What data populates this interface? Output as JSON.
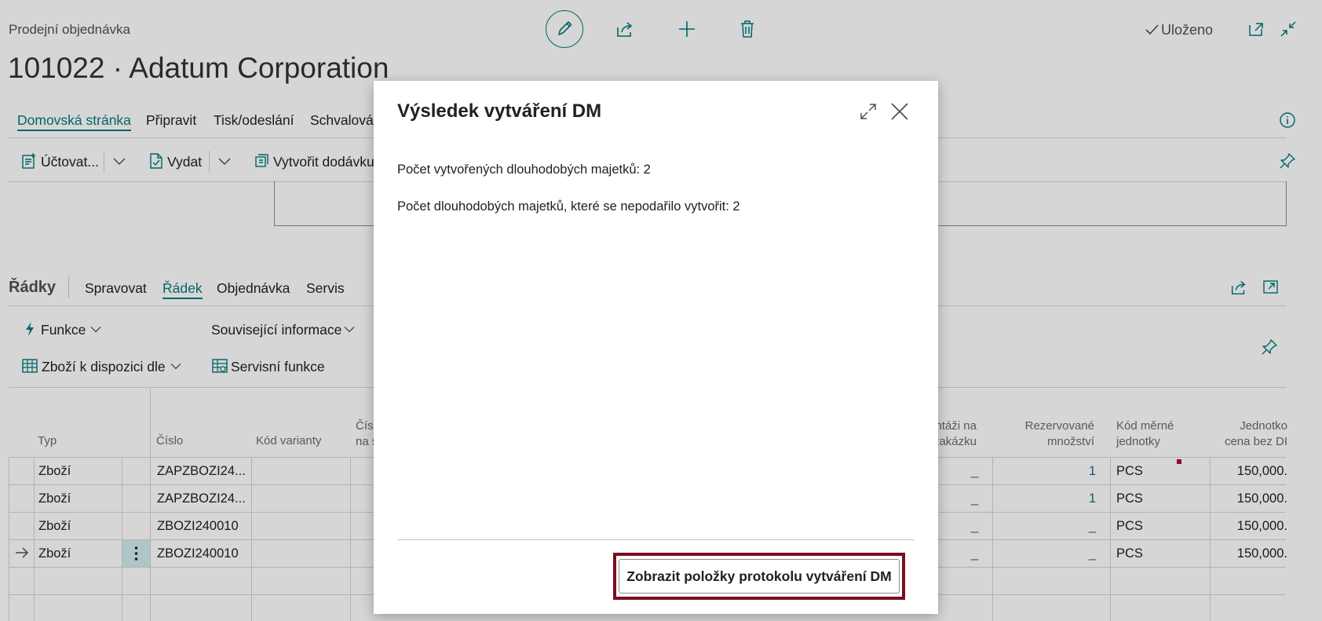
{
  "header": {
    "page_type": "Prodejní objednávka",
    "record_title": "101022 · Adatum Corporation",
    "saved_status": "Uloženo"
  },
  "action_tabs": [
    "Domovská stránka",
    "Připravit",
    "Tisk/odeslání",
    "Schvalování"
  ],
  "toolbar": {
    "post_label": "Účtovat...",
    "release_label": "Vydat",
    "create_shipment_label": "Vytvořit dodávku"
  },
  "lines_section": {
    "title": "Řádky",
    "tabs": [
      "Spravovat",
      "Řádek",
      "Objednávka",
      "Servis"
    ],
    "functions_label": "Funkce",
    "related_info_label": "Související informace",
    "item_availability_label": "Zboží k dispozici dle",
    "service_functions_label": "Servisní funkce"
  },
  "table": {
    "headers": {
      "type": "Typ",
      "number": "Číslo",
      "variant": "Kód varianty",
      "partial_col": [
        "Čís",
        "na s"
      ],
      "assembly": [
        "ntáži na",
        "zakázku"
      ],
      "reserved": [
        "Rezervované",
        "množství"
      ],
      "uom": [
        "Kód měrné",
        "jednotky"
      ],
      "unit_price": [
        "Jednotko",
        "cena bez DI"
      ]
    },
    "rows": [
      {
        "type": "Zboží",
        "number": "ZAPZBOZI24...",
        "assembly": "_",
        "reserved": "1",
        "uom": "PCS",
        "price": "150,000."
      },
      {
        "type": "Zboží",
        "number": "ZAPZBOZI24...",
        "assembly": "_",
        "reserved": "1",
        "uom": "PCS",
        "price": "150,000."
      },
      {
        "type": "Zboží",
        "number": "ZBOZI240010",
        "assembly": "_",
        "reserved": "_",
        "uom": "PCS",
        "price": "150,000."
      },
      {
        "type": "Zboží",
        "number": "ZBOZI240010",
        "assembly": "_",
        "reserved": "_",
        "uom": "PCS",
        "price": "150,000."
      }
    ]
  },
  "dialog": {
    "title": "Výsledek vytváření DM",
    "message_created": "Počet vytvořených dlouhodobých majetků: 2",
    "message_failed": "Počet dlouhodobých majetků, které se nepodařilo vytvořit: 2",
    "button_label": "Zobrazit položky protokolu vytváření DM"
  },
  "colors": {
    "accent": "#00797b",
    "highlight_border": "#7b0e22",
    "selected_cell": "#d2ecec"
  }
}
